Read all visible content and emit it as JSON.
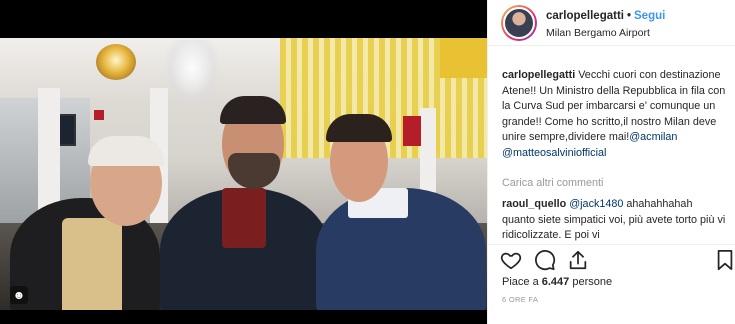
{
  "post": {
    "username": "carlopellegatti",
    "separator": "•",
    "follow_label": "Segui",
    "location": "Milan Bergamo Airport"
  },
  "caption": {
    "username": "carlopellegatti",
    "text_1": " Vecchi cuori con destinazione Atene!! Un Ministro della Repubblica in fila con la Curva Sud per imbarcarsi e' comunque un grande!! Come ho scritto,il nostro Milan deve unire sempre,dividere mai!",
    "mention_1": "@acmilan",
    "mention_2": "@matteosalviniofficial"
  },
  "load_more": "Carica altri commenti",
  "comment": {
    "username": "raoul_quello",
    "mention": "@jack1480",
    "text": " ahahahhahah quanto siete simpatici voi, più avete torto più vi ridicolizzate. E poi vi"
  },
  "likes": {
    "prefix": "Piace a ",
    "count": "6.447",
    "suffix": " persone"
  },
  "timestamp": "6 ORE FA",
  "icons": {
    "like": "heart-icon",
    "comment": "comment-bubble-icon",
    "share": "share-icon",
    "save": "bookmark-icon",
    "photo_badge": "user-tag-icon"
  },
  "colors": {
    "link": "#003569",
    "follow": "#3897f0",
    "muted": "#999999",
    "text": "#262626"
  }
}
